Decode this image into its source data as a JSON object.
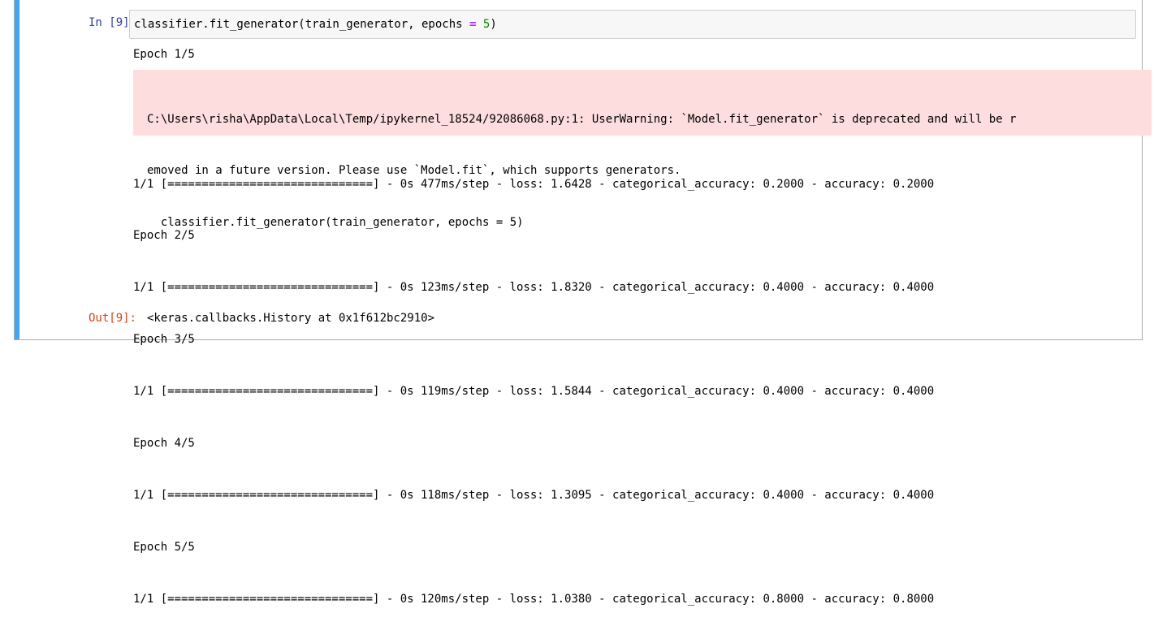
{
  "cell": {
    "in_prompt": "In [9]:",
    "out_prompt": "Out[9]:",
    "code": {
      "prefix": "classifier.fit_generator(train_generator, epochs ",
      "operator": "=",
      "space": " ",
      "number": "5",
      "suffix": ")"
    },
    "stdout_first": "Epoch 1/5",
    "stderr_lines": [
      "C:\\Users\\risha\\AppData\\Local\\Temp/ipykernel_18524/92086068.py:1: UserWarning: `Model.fit_generator` is deprecated and will be r",
      "emoved in a future version. Please use `Model.fit`, which supports generators.",
      "  classifier.fit_generator(train_generator, epochs = 5)"
    ],
    "log_lines": [
      "1/1 [==============================] - 0s 477ms/step - loss: 1.6428 - categorical_accuracy: 0.2000 - accuracy: 0.2000",
      "Epoch 2/5",
      "1/1 [==============================] - 0s 123ms/step - loss: 1.8320 - categorical_accuracy: 0.4000 - accuracy: 0.4000",
      "Epoch 3/5",
      "1/1 [==============================] - 0s 119ms/step - loss: 1.5844 - categorical_accuracy: 0.4000 - accuracy: 0.4000",
      "Epoch 4/5",
      "1/1 [==============================] - 0s 118ms/step - loss: 1.3095 - categorical_accuracy: 0.4000 - accuracy: 0.4000",
      "Epoch 5/5",
      "1/1 [==============================] - 0s 120ms/step - loss: 1.0380 - categorical_accuracy: 0.8000 - accuracy: 0.8000"
    ],
    "output_value": "<keras.callbacks.History at 0x1f612bc2910>"
  },
  "colors": {
    "selected_bar": "#42a5f5",
    "in_prompt": "#303f9f",
    "out_prompt": "#d84315",
    "stderr_bg": "#fddddd"
  }
}
